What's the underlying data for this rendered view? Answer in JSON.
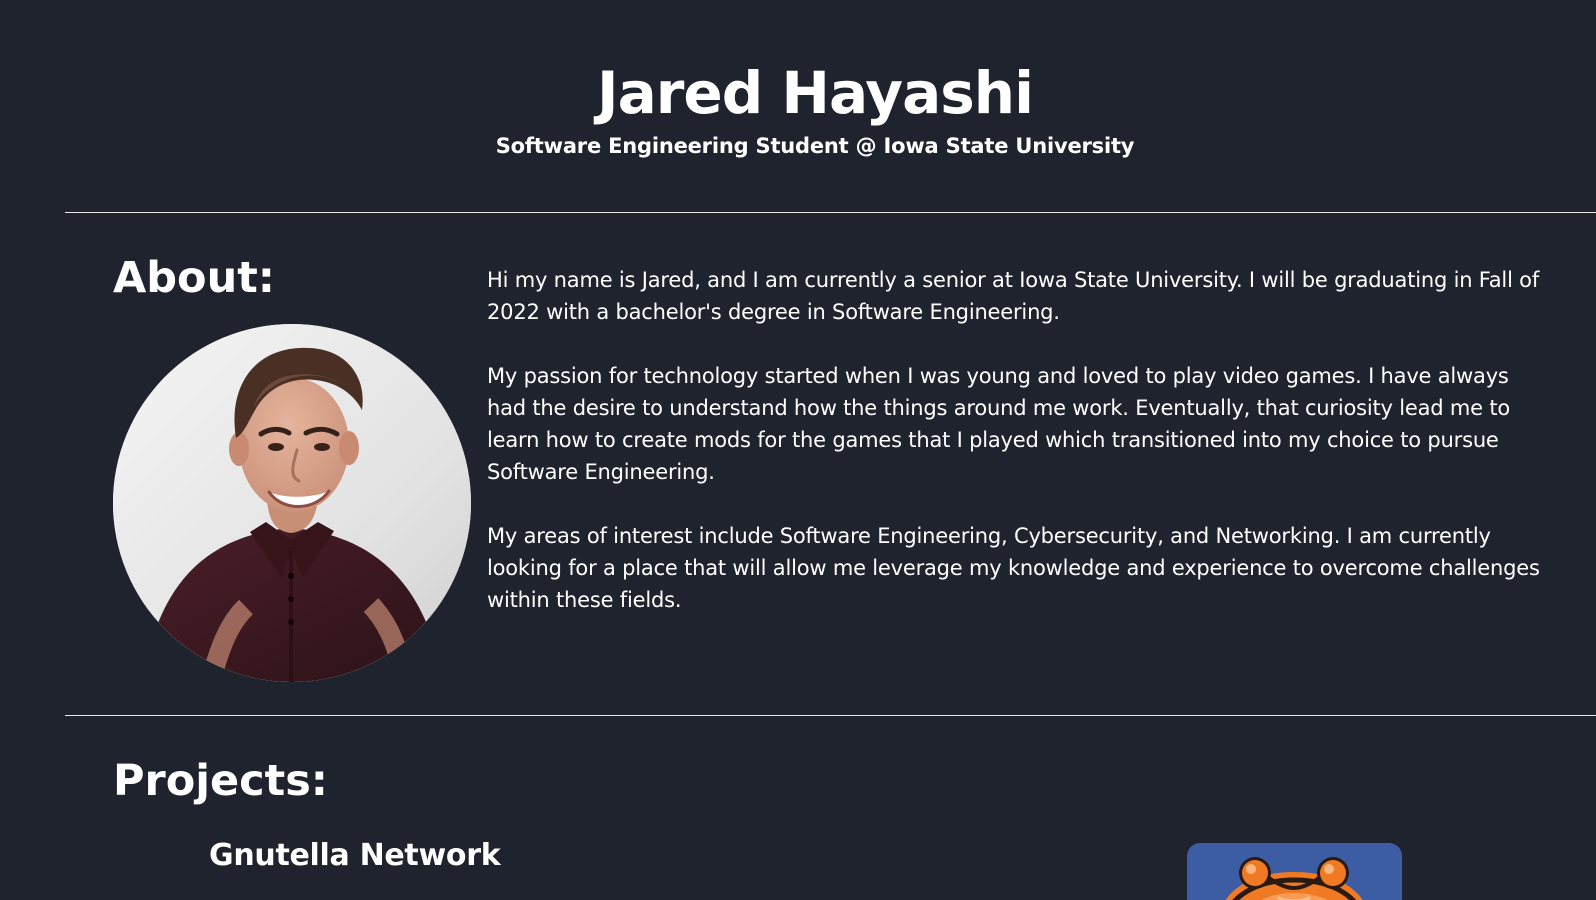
{
  "header": {
    "name": "Jared Hayashi",
    "subtitle": "Software Engineering Student @ Iowa State University"
  },
  "about": {
    "title": "About:",
    "photo_icon": "profile-photo",
    "paragraphs": [
      "Hi my name is Jared, and I am currently a senior at Iowa State University. I will be graduating in Fall of 2022 with a bachelor's degree in Software Engineering.",
      "My passion for technology started when I was young and loved to play video games. I have always had the desire to understand how the things around me work. Eventually, that curiosity lead me to learn how to create mods for the games that I played which transitioned into my choice to pursue Software Engineering.",
      "My areas of interest include Software Engineering, Cybersecurity, and Networking. I am currently looking for a place that will allow me leverage my knowledge and experience to overcome challenges within these fields."
    ]
  },
  "projects": {
    "title": "Projects:",
    "items": [
      {
        "name": "Gnutella Network",
        "thumbnail_icon": "gnutella-logo-icon"
      }
    ]
  },
  "colors": {
    "background": "#1f232d",
    "text": "#ffffff",
    "rule": "#e7e7e7",
    "thumbnail_bg": "#3c5da4",
    "accent_orange": "#f07a24"
  }
}
